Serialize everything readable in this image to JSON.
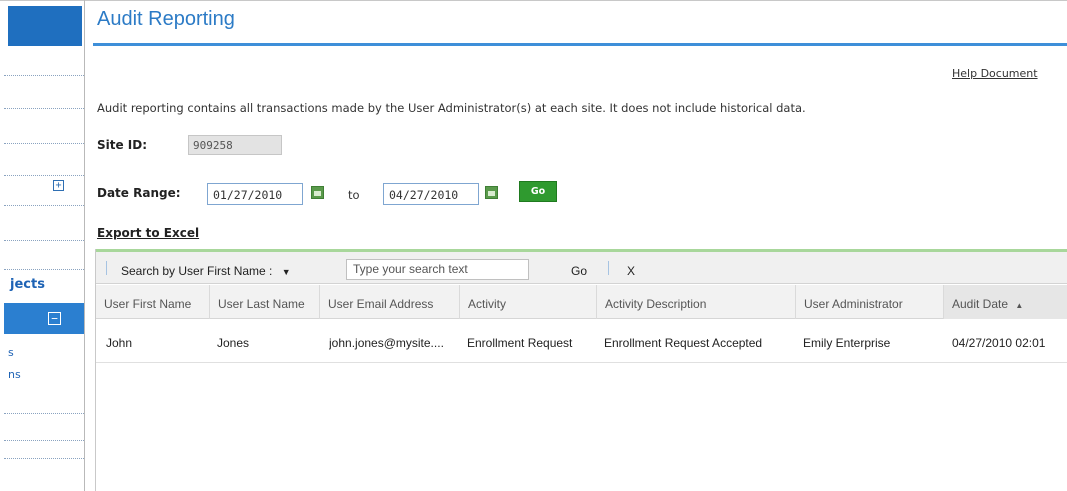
{
  "page": {
    "title": "Audit Reporting",
    "help_link": "Help Document",
    "intro": "Audit reporting contains all transactions made by the User Administrator(s) at each site. It does not include historical data."
  },
  "sidebar": {
    "partial_label": "jects",
    "sub_items": [
      "s",
      "ns"
    ]
  },
  "site": {
    "label": "Site ID:",
    "value": "909258"
  },
  "date_range": {
    "label": "Date Range:",
    "from": "01/27/2010",
    "to_label": "to",
    "to": "04/27/2010",
    "go_label": "Go"
  },
  "export": {
    "label": "Export to Excel"
  },
  "grid": {
    "search": {
      "field_label": "Search by User First Name :",
      "placeholder": "Type your search text",
      "go_label": "Go",
      "clear_label": "X"
    },
    "columns": [
      "User First Name",
      "User Last Name",
      "User Email Address",
      "Activity",
      "Activity Description",
      "User Administrator",
      "Audit Date"
    ],
    "sort_indicator": "▲",
    "rows": [
      {
        "first_name": "John",
        "last_name": "Jones",
        "email": "john.jones@mysite....",
        "activity": "Enrollment Request",
        "description": "Enrollment Request Accepted",
        "administrator": "Emily Enterprise",
        "audit_date": "04/27/2010 02:01"
      }
    ]
  },
  "colors": {
    "accent_blue": "#2c7bc6",
    "go_green": "#2f9a2f",
    "grid_top_green": "#a8d79b"
  }
}
